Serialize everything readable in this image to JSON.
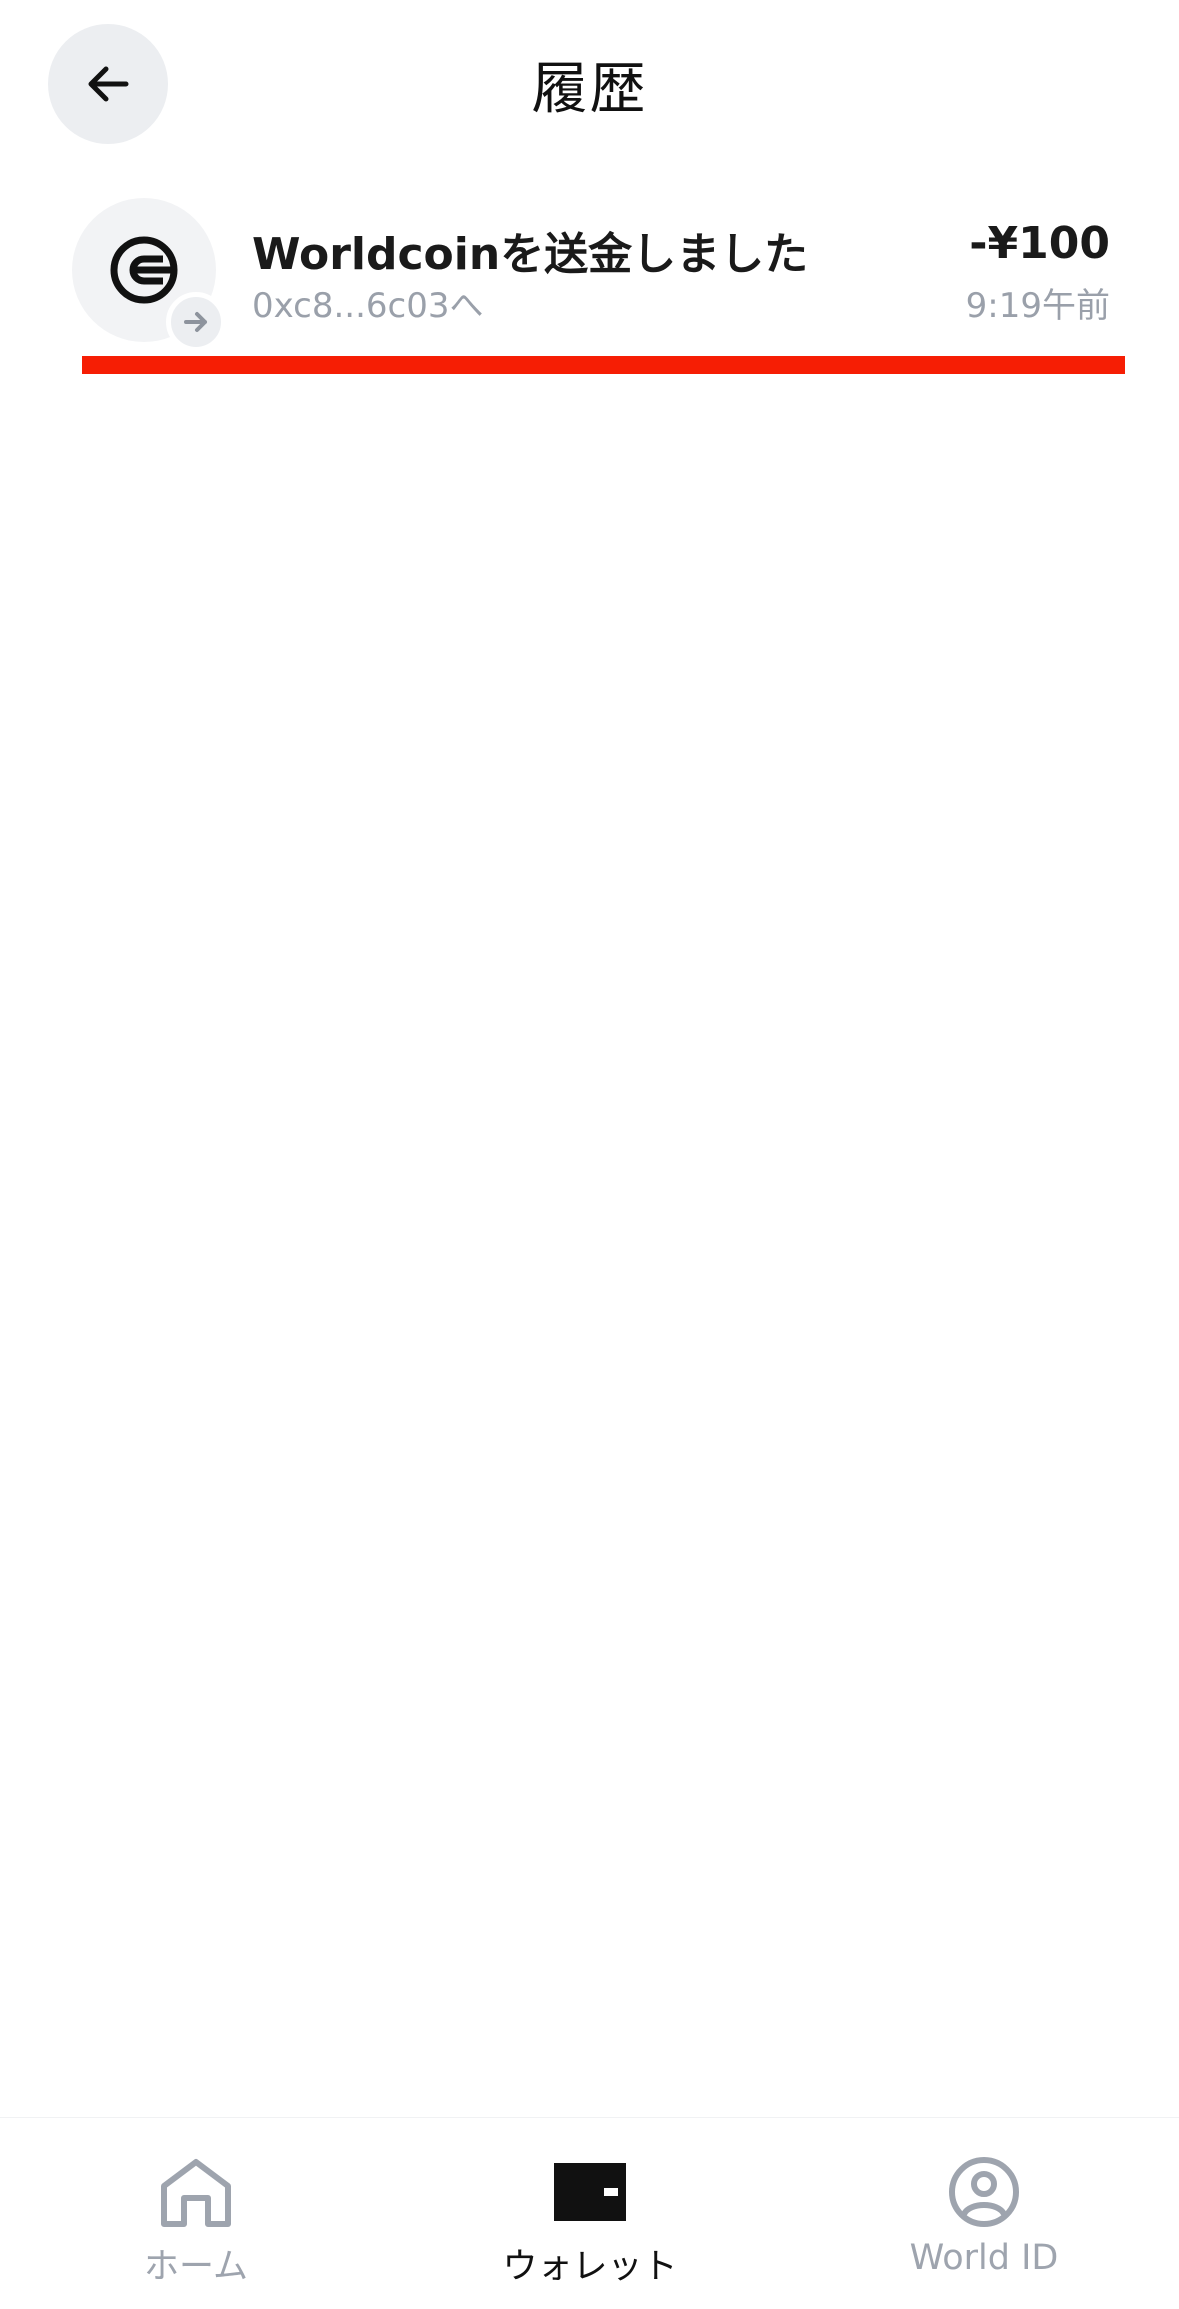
{
  "header": {
    "title": "履歴",
    "back_icon": "arrow-left-icon"
  },
  "transactions": [
    {
      "title": "Worldcoinを送金しました",
      "address": "0xc8...6c03へ",
      "amount": "-¥100",
      "time": "9:19午前",
      "token_icon": "worldcoin-icon",
      "direction_icon": "arrow-right-icon"
    }
  ],
  "highlight_color": "#f61e04",
  "tabbar": {
    "tabs": [
      {
        "label": "ホーム",
        "icon": "home-icon",
        "active": false
      },
      {
        "label": "ウォレット",
        "icon": "wallet-icon",
        "active": true
      },
      {
        "label": "World ID",
        "icon": "user-circle-icon",
        "active": false
      }
    ]
  }
}
